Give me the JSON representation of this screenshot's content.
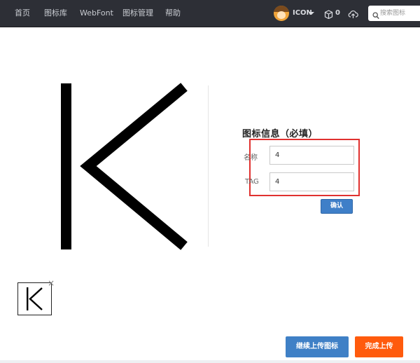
{
  "nav": {
    "items": [
      {
        "label": "首页"
      },
      {
        "label": "图标库"
      },
      {
        "label": "WebFont"
      },
      {
        "label": "图标管理"
      },
      {
        "label": "帮助"
      }
    ],
    "user_name": "ICON",
    "cart_count": "0",
    "search_placeholder": "搜索图标"
  },
  "form": {
    "title": "图标信息（必填）",
    "name_label": "名称",
    "name_value": "4",
    "tag_label": "TAG",
    "tag_value": "4",
    "confirm_label": "确认"
  },
  "thumbnail": {
    "close_symbol": "×"
  },
  "actions": {
    "continue_label": "继续上传图标",
    "finish_label": "完成上传"
  },
  "colors": {
    "nav_bg": "#2d2f36",
    "highlight": "#e0312f",
    "primary_blue": "#3f80c6",
    "finish_orange": "#ff5b0d"
  }
}
